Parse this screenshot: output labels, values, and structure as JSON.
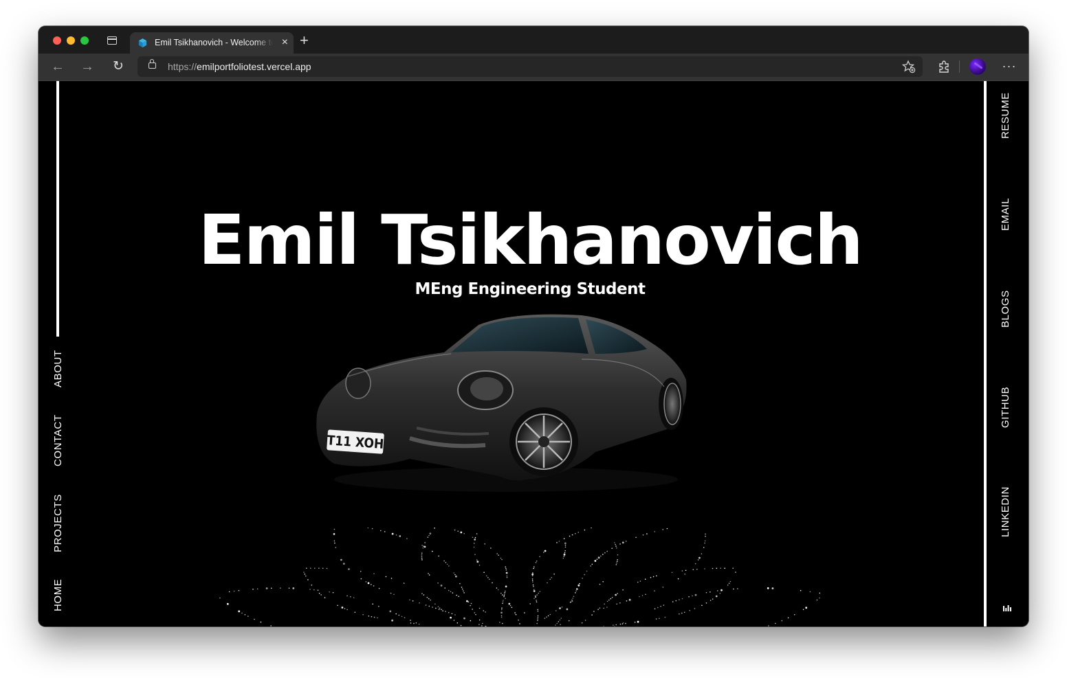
{
  "browser": {
    "tab_title": "Emil Tsikhanovich - Welcome to my portfolio",
    "tab_close": "×",
    "new_tab": "+",
    "url_scheme": "https://",
    "url_host": "emilportfoliotest.vercel.app",
    "back": "←",
    "forward": "→",
    "reload": "↻",
    "more": "···",
    "colors": {
      "chrome": "#1c1c1c",
      "toolbar": "#333333",
      "accent": "#fe5f57"
    }
  },
  "left_nav": {
    "items": [
      {
        "label": "ABOUT"
      },
      {
        "label": "CONTACT"
      },
      {
        "label": "PROJECTS"
      },
      {
        "label": "HOME"
      }
    ]
  },
  "right_nav": {
    "items": [
      {
        "label": "RESUME"
      },
      {
        "label": "EMAIL"
      },
      {
        "label": "BLOGS"
      },
      {
        "label": "GITHUB"
      },
      {
        "label": "LINKEDIN"
      }
    ]
  },
  "hero": {
    "title": "Emil Tsikhanovich",
    "subtitle": "MEng Engineering Student",
    "plate": "T11 XOH"
  }
}
